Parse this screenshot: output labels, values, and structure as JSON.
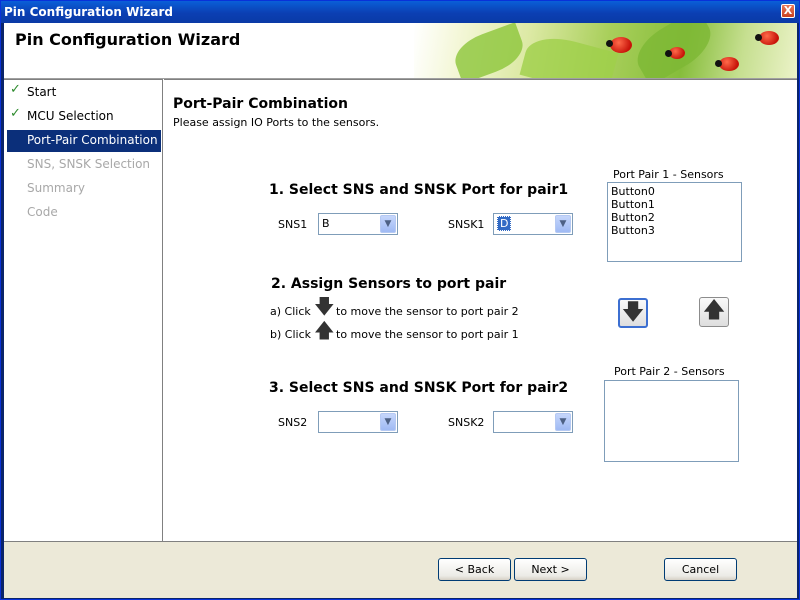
{
  "window": {
    "title": "Pin Configuration Wizard",
    "close_label": "X"
  },
  "header": {
    "title": "Pin Configuration Wizard"
  },
  "steps": [
    {
      "label": "Start",
      "state": "done"
    },
    {
      "label": "MCU Selection",
      "state": "done"
    },
    {
      "label": "Port-Pair Combination",
      "state": "active"
    },
    {
      "label": "SNS, SNSK Selection",
      "state": "disabled"
    },
    {
      "label": "Summary",
      "state": "disabled"
    },
    {
      "label": "Code",
      "state": "disabled"
    }
  ],
  "content": {
    "title": "Port-Pair Combination",
    "subtitle": "Please assign IO Ports to the sensors.",
    "section1": {
      "heading": "1. Select SNS and SNSK Port for pair1",
      "sns_label": "SNS1",
      "sns_value": "B",
      "snsk_label": "SNSK1",
      "snsk_value": "D"
    },
    "section2": {
      "heading": "2. Assign Sensors to port pair",
      "line_a_prefix": "a) Click",
      "line_a_suffix": "to move the sensor to port pair 2",
      "line_b_prefix": "b) Click",
      "line_b_suffix": "to move the sensor to port pair 1"
    },
    "section3": {
      "heading": "3. Select SNS and SNSK Port for pair2",
      "sns_label": "SNS2",
      "sns_value": "",
      "snsk_label": "SNSK2",
      "snsk_value": ""
    },
    "pair1": {
      "label": "Port Pair 1 - Sensors",
      "items": [
        "Button0",
        "Button1",
        "Button2",
        "Button3"
      ]
    },
    "pair2": {
      "label": "Port Pair 2 - Sensors",
      "items": []
    }
  },
  "footer": {
    "back_label": "< Back",
    "next_label": "Next >",
    "cancel_label": "Cancel"
  }
}
